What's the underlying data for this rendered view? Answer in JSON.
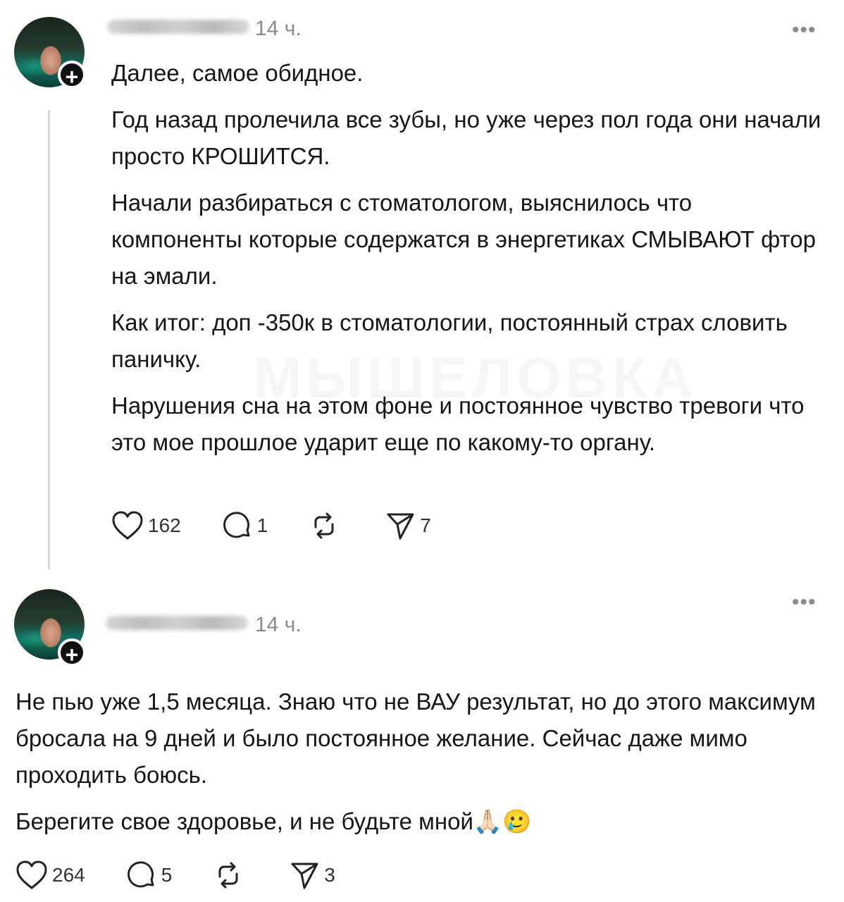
{
  "posts": [
    {
      "time": "14 ч.",
      "more": "•••",
      "paragraphs": [
        "Далее, самое обидное.",
        "Год назад пролечила все зубы, но уже через пол года они начали просто КРОШИТСЯ.",
        "Начали разбираться с стоматологом, выяснилось что компоненты которые содержатся в энергетиках СМЫВАЮТ фтор на эмали.",
        "Как итог: доп -350к в стоматологии, постоянный страх словить паничку.",
        "Нарушения сна на этом фоне и постоянное чувство тревоги что это мое прошлое ударит еще по какому-то органу."
      ],
      "likes": "162",
      "comments": "1",
      "reposts": "",
      "shares": "7"
    },
    {
      "time": "14 ч.",
      "more": "•••",
      "paragraphs": [
        "Не пью уже 1,5 месяца. Знаю что не ВАУ результат, но до этого максимум бросала на 9 дней и было постоянное желание. Сейчас даже мимо проходить боюсь.",
        "Берегите свое здоровье, и не будьте мной🙏🏻🥲"
      ],
      "likes": "264",
      "comments": "5",
      "reposts": "",
      "shares": "3"
    }
  ],
  "watermark": "МЫШЕЛОВКА",
  "icons": {
    "like": "heart-icon",
    "comment": "comment-icon",
    "repost": "repost-icon",
    "share": "send-icon",
    "more": "more-icon",
    "follow": "plus-icon"
  }
}
